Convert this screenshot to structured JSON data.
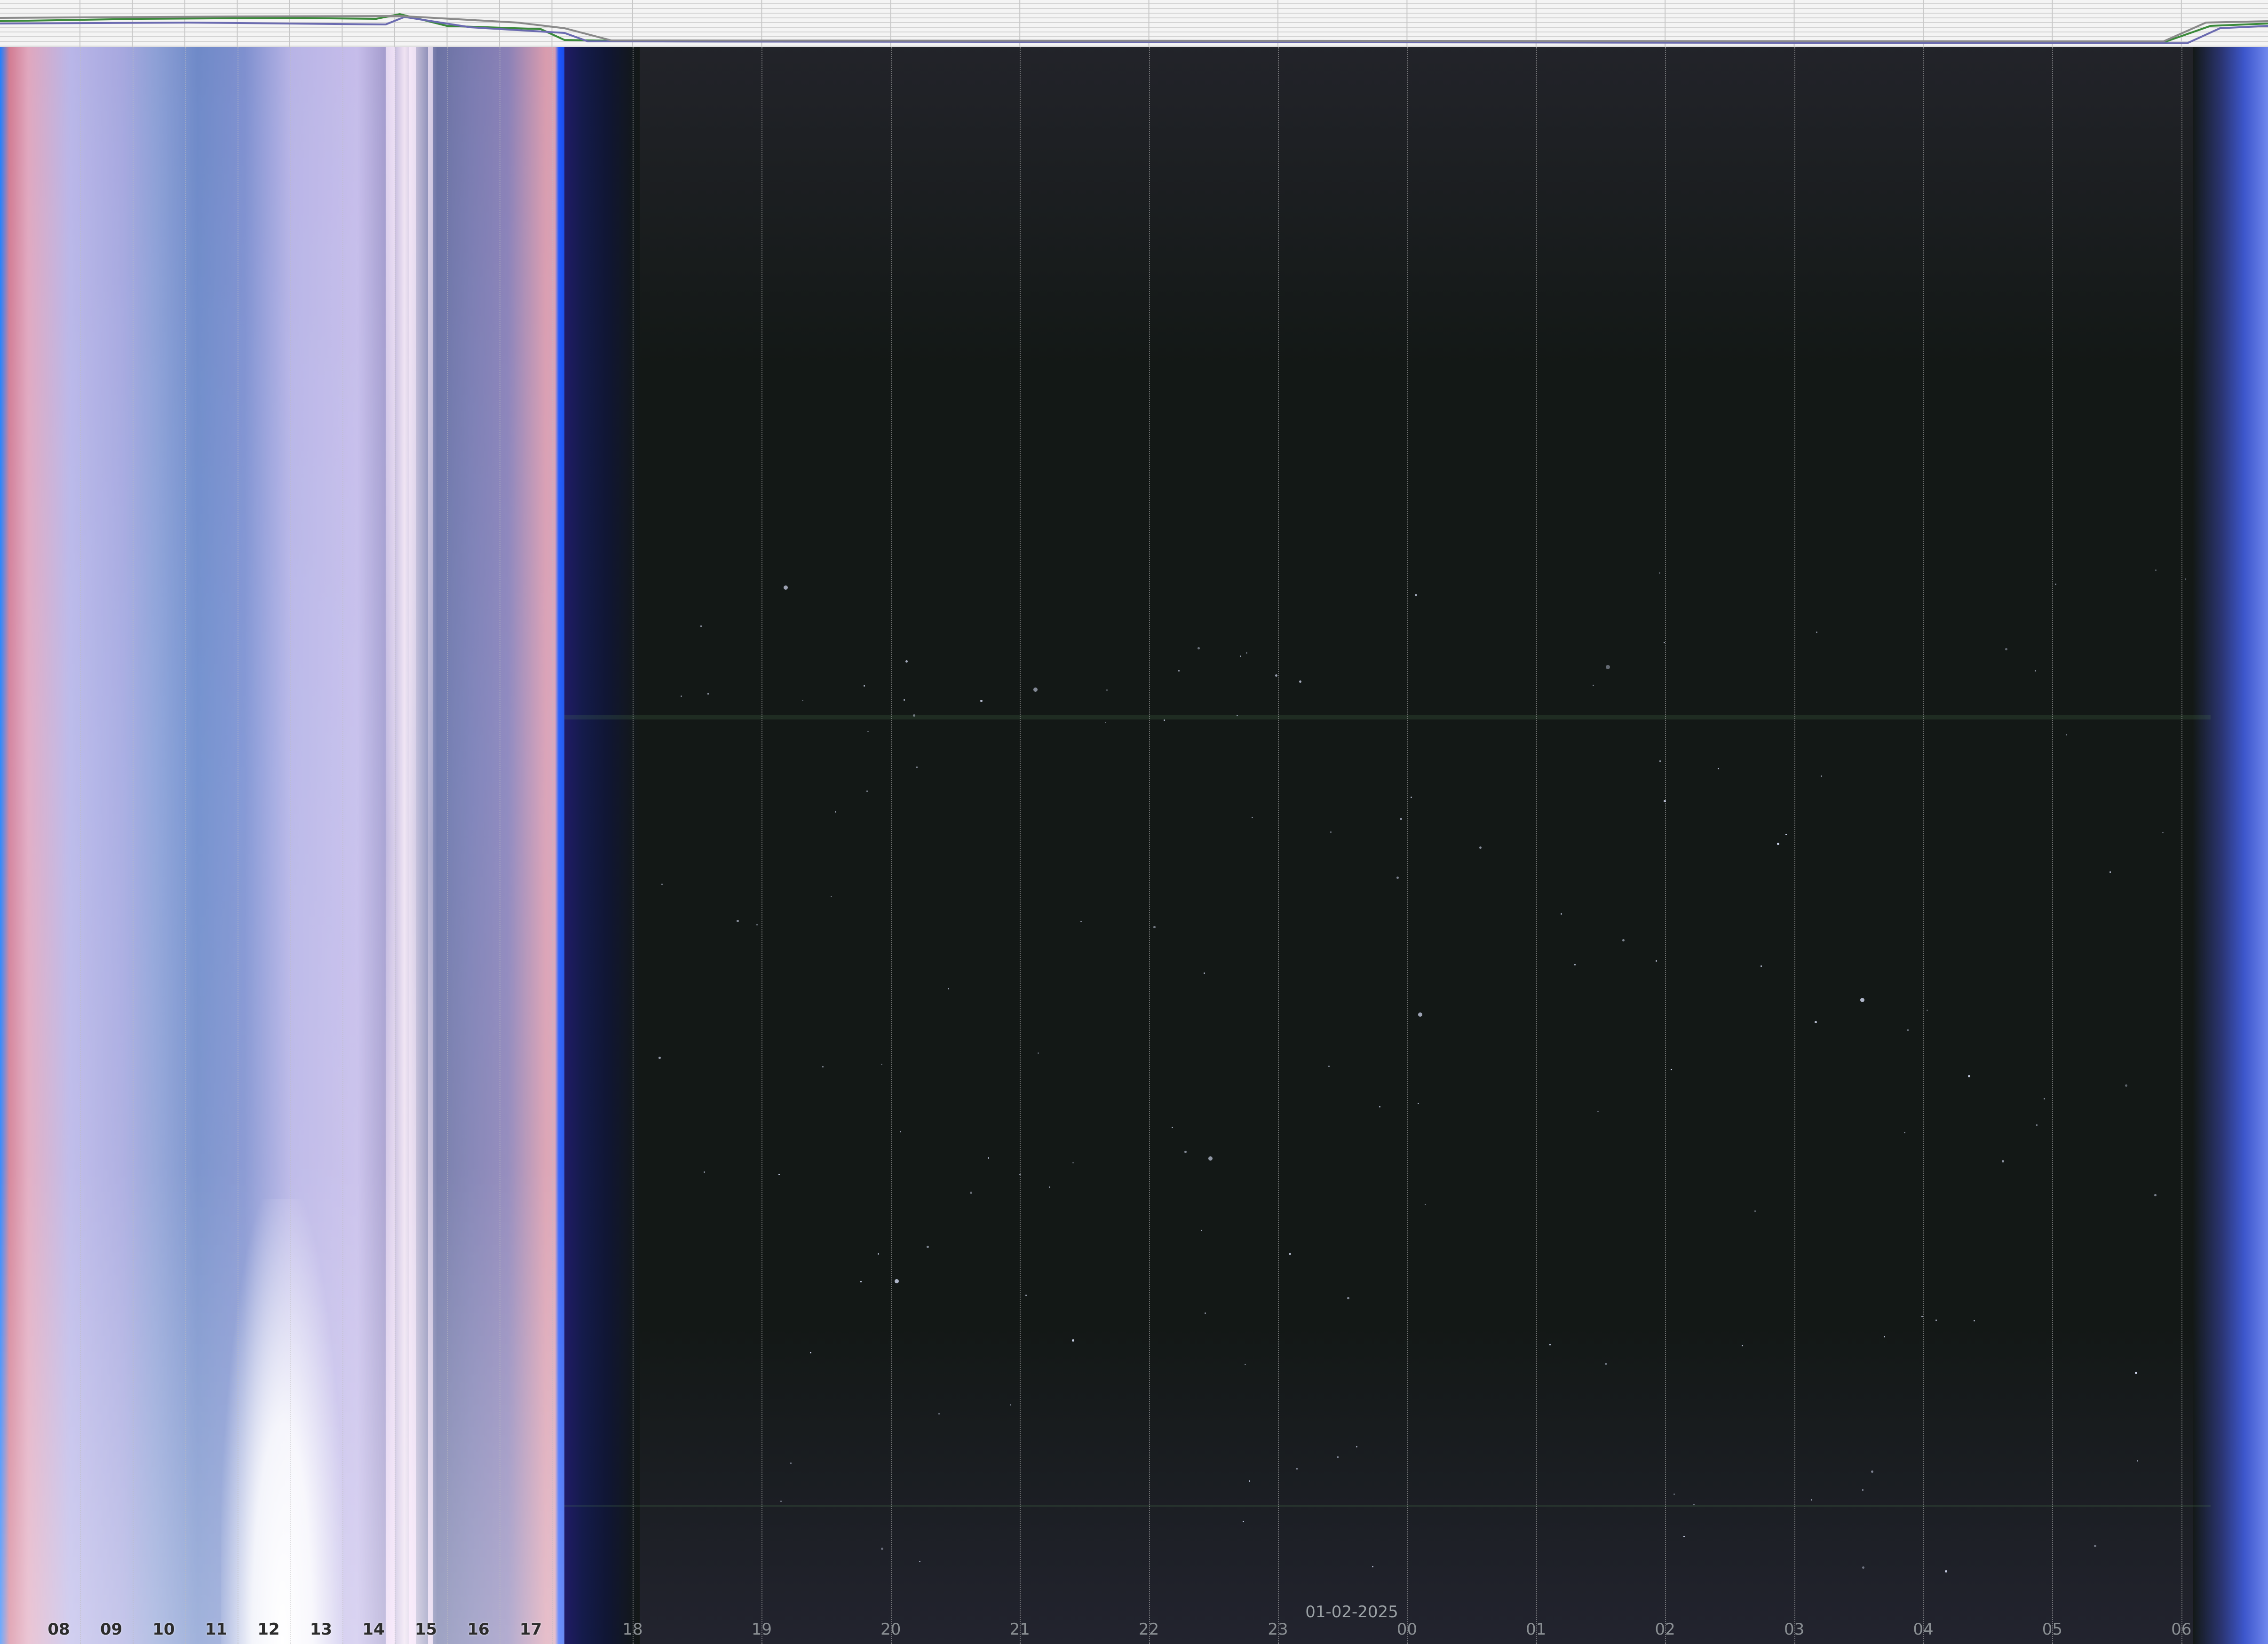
{
  "date": "01-02-2025",
  "hours": [
    "08",
    "09",
    "10",
    "11",
    "12",
    "13",
    "14",
    "15",
    "16",
    "17",
    "18",
    "19",
    "20",
    "21",
    "22",
    "23",
    "00",
    "01",
    "02",
    "03",
    "04",
    "05",
    "06"
  ],
  "daytime_hours": [
    "08",
    "09",
    "10",
    "11",
    "12",
    "13",
    "14",
    "15",
    "16",
    "17"
  ],
  "colors": {
    "sky_day": "#a7a8df",
    "sky_night": "#131816",
    "dusk_blue": "#1a4ce8",
    "dawn_blue": "#5b73e0",
    "grid_line": "#bebebe"
  }
}
